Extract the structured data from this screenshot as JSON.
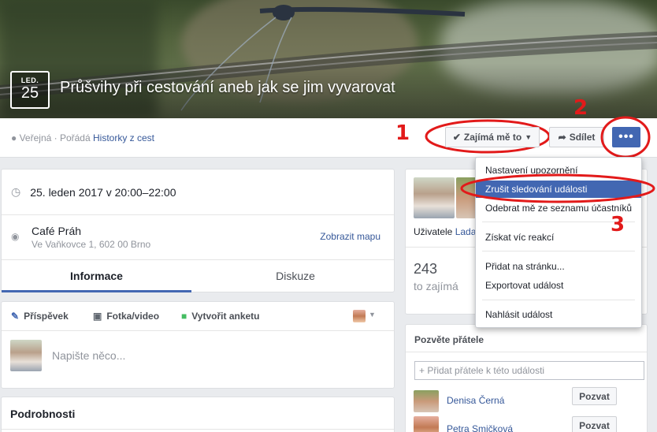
{
  "event": {
    "month": "LED.",
    "day": "25",
    "title": "Průšvihy při cestování aneb jak se jim vyvarovat",
    "privacy": "Veřejná · Pořádá",
    "host": "Historky z cest"
  },
  "actions": {
    "interested": "Zajímá mě to",
    "share": "Sdílet",
    "more": "•••"
  },
  "annotations": {
    "one": "1",
    "two": "2",
    "three": "3"
  },
  "colors": {
    "accent": "#4267b2",
    "annotation": "#e21a1a"
  },
  "info": {
    "datetime": "25. leden 2017 v 20:00–22:00",
    "place_name": "Café Práh",
    "place_address": "Ve Vaňkovce 1, 602 00 Brno",
    "map_link": "Zobrazit mapu",
    "tabs": [
      "Informace",
      "Diskuze"
    ]
  },
  "composer": {
    "tabs": [
      "Příspěvek",
      "Fotka/video",
      "Vytvořit anketu"
    ],
    "placeholder": "Napište něco..."
  },
  "details": {
    "heading": "Podrobnosti"
  },
  "right": {
    "users_prefix": "Uživatele",
    "users_name": "Lada",
    "count": "243",
    "count_label": "to zajímá"
  },
  "invite": {
    "heading": "Pozvěte přátele",
    "search_placeholder": "+ Přidat přátele k této události",
    "friends": [
      {
        "name": "Denisa Černá",
        "button": "Pozvat"
      },
      {
        "name": "Petra Smičková",
        "button": "Pozvat"
      }
    ]
  },
  "menu": {
    "items": [
      "Nastavení upozornění",
      "Zrušit sledování události",
      "Odebrat mě ze seznamu účastníků",
      "Získat víc reakcí",
      "Přidat na stránku...",
      "Exportovat událost",
      "Nahlásit událost"
    ]
  }
}
